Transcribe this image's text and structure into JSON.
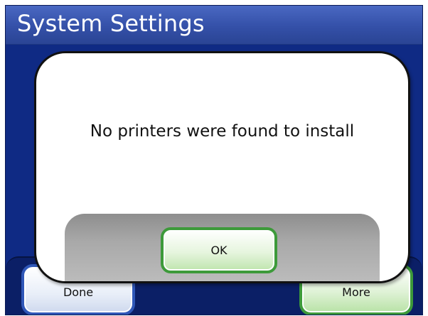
{
  "window": {
    "title": "System Settings"
  },
  "nav": {
    "done_label": "Done",
    "more_label": "More"
  },
  "dialog": {
    "message": "No printers were found to install",
    "ok_label": "OK"
  },
  "colors": {
    "background": "#0f2a84",
    "title_bar": "#3450a8",
    "done_border": "#2f57b8",
    "confirm_border": "#3d9a3a",
    "dialog_footer": "#a9a9a9"
  }
}
